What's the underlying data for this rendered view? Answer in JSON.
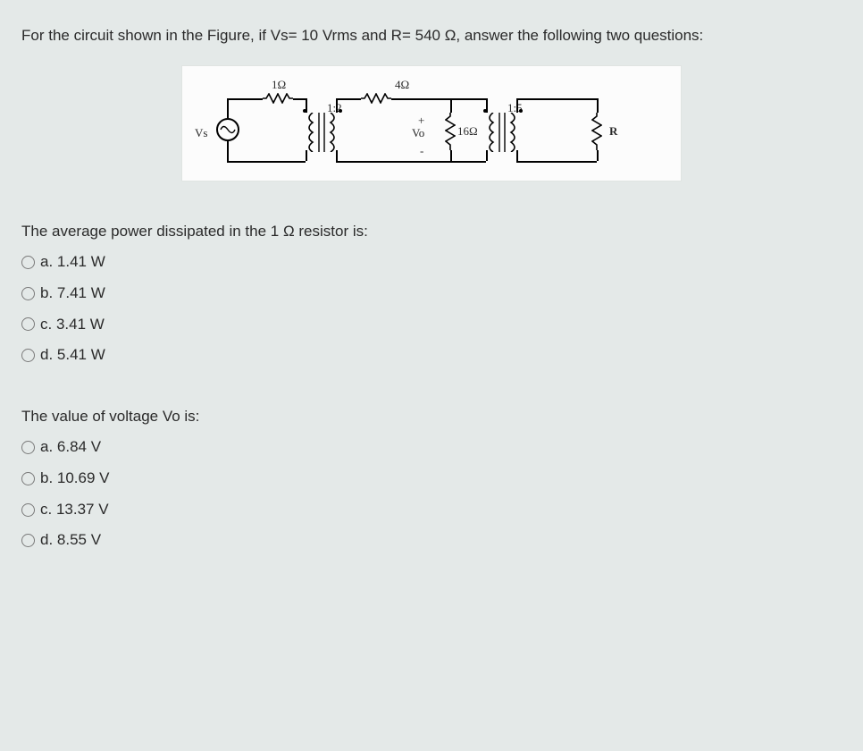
{
  "stem": "For the circuit shown in the Figure, if Vs= 10 Vrms and R= 540 Ω, answer the following two questions:",
  "circuit": {
    "r1_label": "1Ω",
    "r4_label": "4Ω",
    "vo_plus": "+",
    "vo_minus": "-",
    "vo_label": "Vo",
    "r16_label": "16Ω",
    "vs_label": "Vs",
    "r_label": "R",
    "t1_ratio": "1:2",
    "t2_ratio": "1:5"
  },
  "q1": {
    "text": "The average power dissipated in the 1 Ω resistor is:",
    "options": {
      "a": "a. 1.41 W",
      "b": "b. 7.41 W",
      "c": "c. 3.41 W",
      "d": "d. 5.41 W"
    }
  },
  "q2": {
    "text": "The value of voltage Vo is:",
    "options": {
      "a": "a. 6.84 V",
      "b": "b. 10.69 V",
      "c": "c. 13.37 V",
      "d": "d. 8.55 V"
    }
  }
}
